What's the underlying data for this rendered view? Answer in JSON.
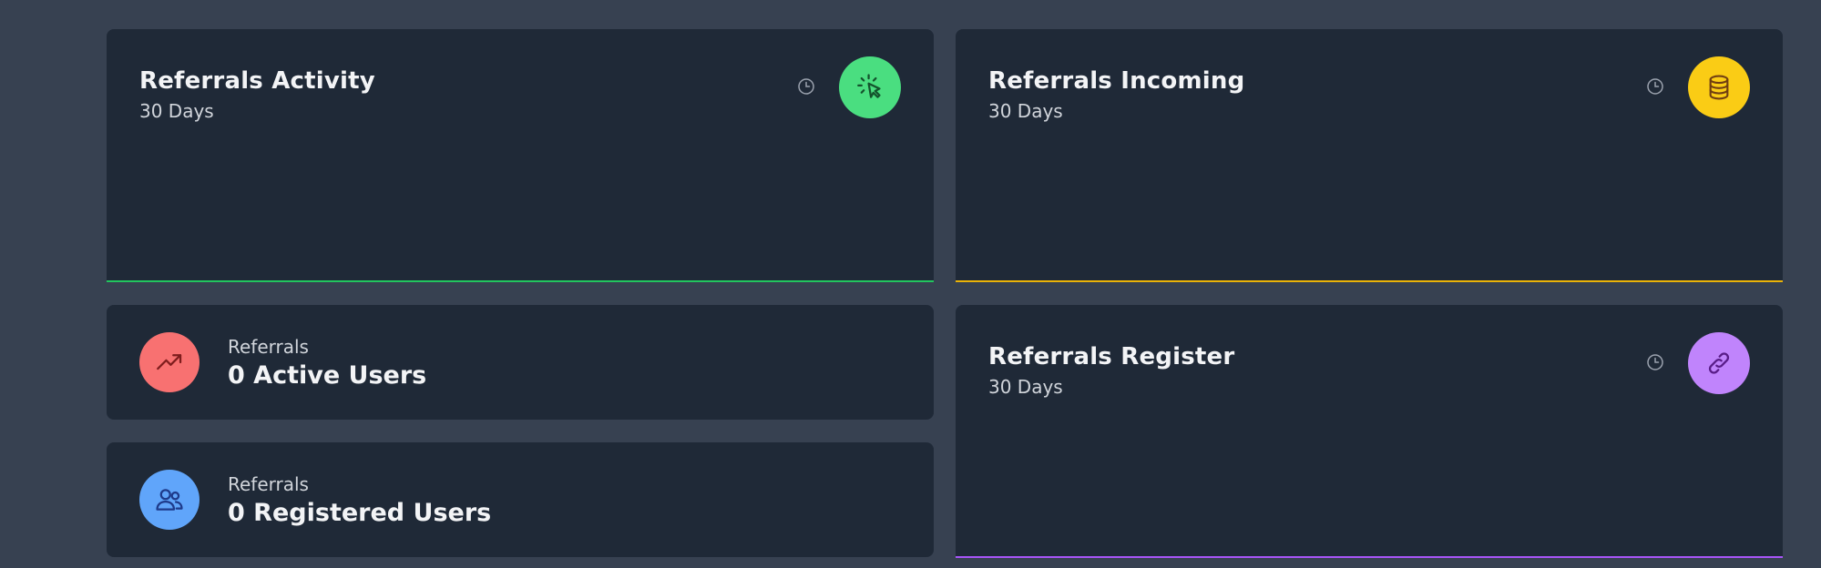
{
  "activity": {
    "title": "Referrals Activity",
    "subtitle": "30 Days",
    "accent": "#4ade80",
    "line_color": "#22c55e",
    "icon": "cursor-click-icon"
  },
  "incoming": {
    "title": "Referrals Incoming",
    "subtitle": "30 Days",
    "accent": "#facc15",
    "line_color": "#eab308",
    "icon": "coins-stack-icon"
  },
  "register": {
    "title": "Referrals Register",
    "subtitle": "30 Days",
    "accent": "#c084fc",
    "line_color": "#a855f7",
    "icon": "link-icon"
  },
  "active_users": {
    "label": "Referrals",
    "value": "0 Active Users",
    "accent": "#f87171",
    "icon": "trending-up-icon"
  },
  "registered_users": {
    "label": "Referrals",
    "value": "0 Registered Users",
    "accent": "#60a5fa",
    "icon": "users-icon"
  }
}
